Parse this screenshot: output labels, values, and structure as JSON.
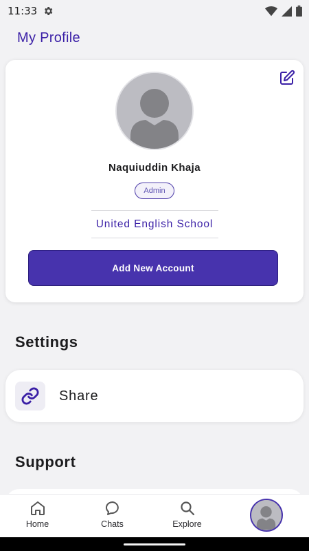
{
  "status_bar": {
    "time": "11:33"
  },
  "header": {
    "title": "My Profile"
  },
  "profile": {
    "name": "Naquiuddin Khaja",
    "role": "Admin",
    "school": "United English School",
    "add_account_label": "Add New Account"
  },
  "settings": {
    "heading": "Settings",
    "items": [
      {
        "label": "Share",
        "icon": "link-icon"
      }
    ]
  },
  "support": {
    "heading": "Support"
  },
  "bottom_nav": {
    "items": [
      {
        "label": "Home",
        "icon": "home-icon"
      },
      {
        "label": "Chats",
        "icon": "chat-bubble-icon"
      },
      {
        "label": "Explore",
        "icon": "search-icon"
      }
    ],
    "active": "profile"
  },
  "colors": {
    "accent": "#4733ad",
    "title": "#3a1fa6",
    "background": "#f2f2f4"
  }
}
